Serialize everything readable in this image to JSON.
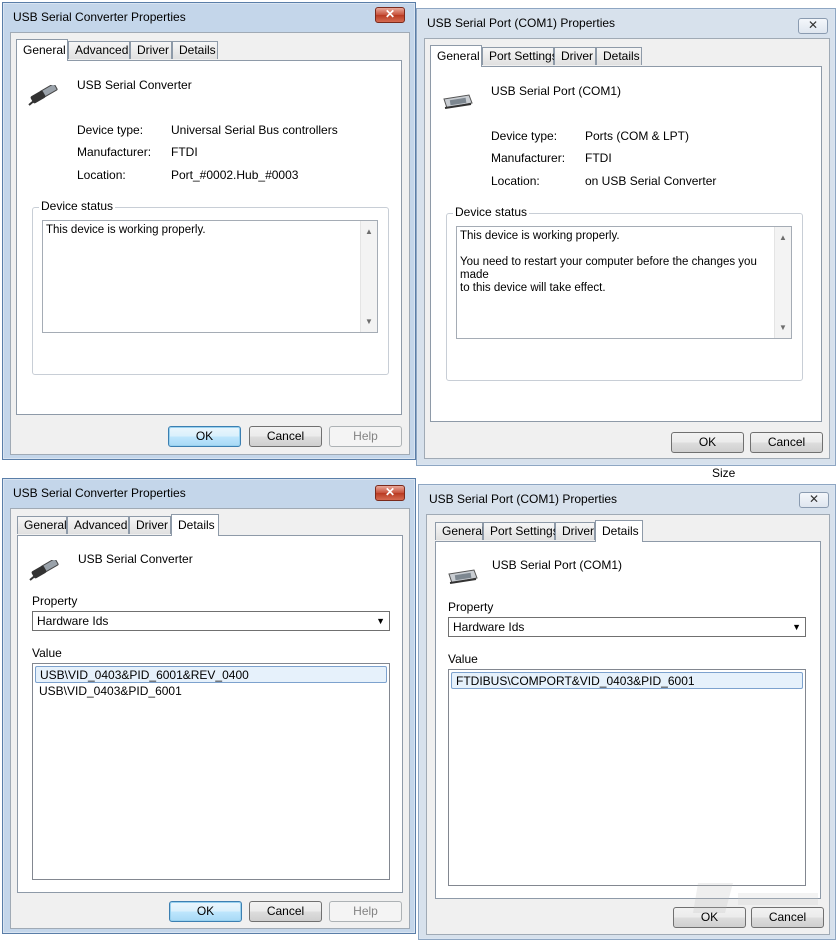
{
  "dialog1": {
    "title": "USB Serial Converter Properties",
    "close": "✕",
    "tabs": [
      "General",
      "Advanced",
      "Driver",
      "Details"
    ],
    "device_name": "USB Serial Converter",
    "rows": [
      {
        "label": "Device type:",
        "value": "Universal Serial Bus controllers"
      },
      {
        "label": "Manufacturer:",
        "value": "FTDI"
      },
      {
        "label": "Location:",
        "value": "Port_#0002.Hub_#0003"
      }
    ],
    "status_group": "Device status",
    "status_text": "This device is working properly.",
    "buttons": {
      "ok": "OK",
      "cancel": "Cancel",
      "help": "Help"
    }
  },
  "dialog2": {
    "title": "USB Serial Port (COM1) Properties",
    "close": "✕",
    "tabs": [
      "General",
      "Port Settings",
      "Driver",
      "Details"
    ],
    "device_name": "USB Serial Port (COM1)",
    "rows": [
      {
        "label": "Device type:",
        "value": "Ports (COM & LPT)"
      },
      {
        "label": "Manufacturer:",
        "value": "FTDI"
      },
      {
        "label": "Location:",
        "value": "on USB Serial Converter"
      }
    ],
    "status_group": "Device status",
    "status_line1": "This device is working properly.",
    "status_line2": "You need to restart your computer before the changes you made",
    "status_line3": "to this device will take effect.",
    "buttons": {
      "ok": "OK",
      "cancel": "Cancel"
    }
  },
  "dialog3": {
    "title": "USB Serial Converter Properties",
    "close": "✕",
    "tabs": [
      "General",
      "Advanced",
      "Driver",
      "Details"
    ],
    "device_name": "USB Serial Converter",
    "property_label": "Property",
    "property_value": "Hardware Ids",
    "value_label": "Value",
    "values": [
      "USB\\VID_0403&PID_6001&REV_0400",
      "USB\\VID_0403&PID_6001"
    ],
    "buttons": {
      "ok": "OK",
      "cancel": "Cancel",
      "help": "Help"
    }
  },
  "dialog4": {
    "title": "USB Serial Port (COM1) Properties",
    "close": "✕",
    "tabs": [
      "General",
      "Port Settings",
      "Driver",
      "Details"
    ],
    "device_name": "USB Serial Port (COM1)",
    "property_label": "Property",
    "property_value": "Hardware Ids",
    "value_label": "Value",
    "values": [
      "FTDIBUS\\COMPORT&VID_0403&PID_6001"
    ],
    "buttons": {
      "ok": "OK",
      "cancel": "Cancel"
    }
  },
  "background": {
    "size_label": "Size"
  },
  "colors": {
    "active_frame": "#c4d6ea",
    "inactive_frame": "#d7e1ec",
    "selected_row": "#e6f1fb"
  }
}
